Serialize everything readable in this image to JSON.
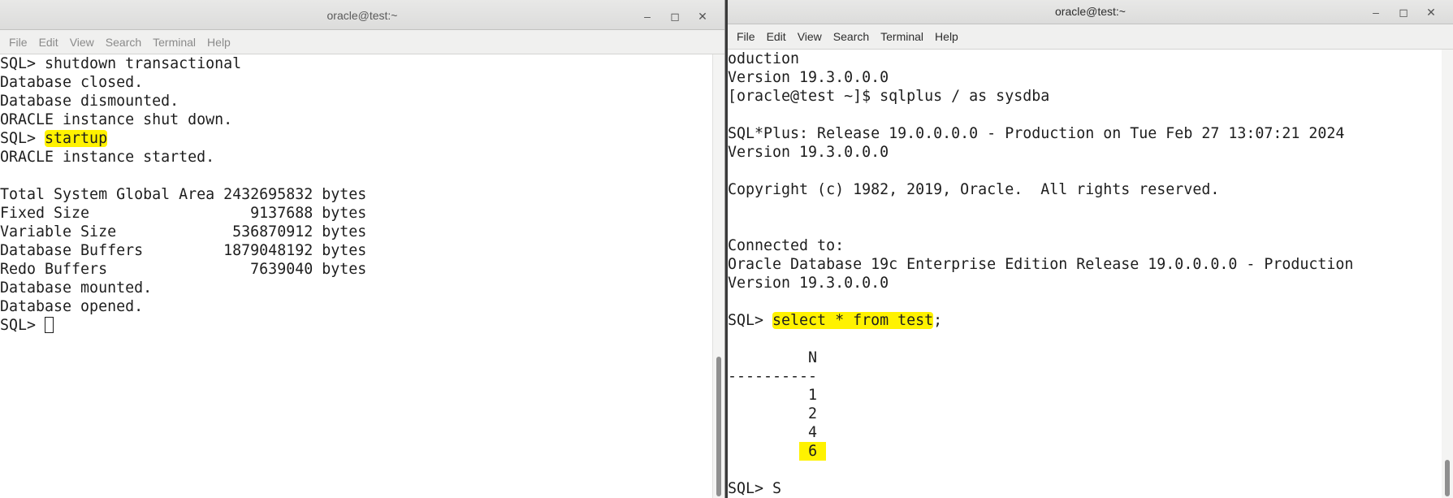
{
  "left_window": {
    "title": "oracle@test:~",
    "menu": [
      "File",
      "Edit",
      "View",
      "Search",
      "Terminal",
      "Help"
    ],
    "lines": [
      {
        "pre": "SQL> shutdown transactional"
      },
      {
        "pre": "Database closed."
      },
      {
        "pre": "Database dismounted."
      },
      {
        "pre": "ORACLE instance shut down."
      },
      {
        "pre": "SQL> ",
        "hl": "startup"
      },
      {
        "pre": "ORACLE instance started."
      },
      {
        "pre": ""
      },
      {
        "pre": "Total System Global Area 2432695832 bytes"
      },
      {
        "pre": "Fixed Size                  9137688 bytes"
      },
      {
        "pre": "Variable Size             536870912 bytes"
      },
      {
        "pre": "Database Buffers         1879048192 bytes"
      },
      {
        "pre": "Redo Buffers                7639040 bytes"
      },
      {
        "pre": "Database mounted."
      },
      {
        "pre": "Database opened."
      },
      {
        "pre": "SQL> ",
        "cursor": true
      }
    ]
  },
  "right_window": {
    "title": "oracle@test:~",
    "menu": [
      "File",
      "Edit",
      "View",
      "Search",
      "Terminal",
      "Help"
    ],
    "lines": [
      {
        "pre": "oduction"
      },
      {
        "pre": "Version 19.3.0.0.0"
      },
      {
        "pre": "[oracle@test ~]$ sqlplus / as sysdba"
      },
      {
        "pre": ""
      },
      {
        "pre": "SQL*Plus: Release 19.0.0.0.0 - Production on Tue Feb 27 13:07:21 2024"
      },
      {
        "pre": "Version 19.3.0.0.0"
      },
      {
        "pre": ""
      },
      {
        "pre": "Copyright (c) 1982, 2019, Oracle.  All rights reserved."
      },
      {
        "pre": ""
      },
      {
        "pre": ""
      },
      {
        "pre": "Connected to:"
      },
      {
        "pre": "Oracle Database 19c Enterprise Edition Release 19.0.0.0.0 - Production"
      },
      {
        "pre": "Version 19.3.0.0.0"
      },
      {
        "pre": ""
      },
      {
        "pre": "SQL> ",
        "hl": "select * from test",
        "post": ";"
      },
      {
        "pre": ""
      },
      {
        "pre": "         N"
      },
      {
        "pre": "----------"
      },
      {
        "pre": "         1"
      },
      {
        "pre": "         2"
      },
      {
        "pre": "         4"
      },
      {
        "pre": "        ",
        "hl_block": " 6 "
      },
      {
        "pre": ""
      },
      {
        "pre": "SQL> S"
      }
    ]
  },
  "highlight_color": "#fff200"
}
